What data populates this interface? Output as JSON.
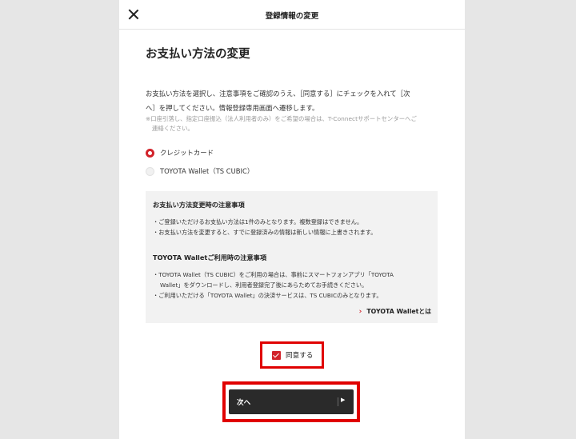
{
  "header": {
    "title": "登録情報の変更"
  },
  "page": {
    "title": "お支払い方法の変更",
    "intro_line1": "お支払い方法を選択し、注意事項をご確認のうえ、［同意する］にチェックを入れて［次",
    "intro_line2": "へ］を押してください。情報登録専用画面へ遷移します。",
    "note_line1": "※口座引落し、指定口座振込（法人利用者のみ）をご希望の場合は、T-Connectサポートセンターへご",
    "note_line2": "連絡ください。"
  },
  "payment_options": [
    {
      "label": "クレジットカード",
      "selected": true
    },
    {
      "label": "TOYOTA Wallet（TS CUBIC）",
      "selected": false
    }
  ],
  "notes": {
    "change_heading": "お支払い方法変更時の注意事項",
    "change_item1": "・ご登録いただけるお支払い方法は1件のみとなります。複数登録はできません。",
    "change_item2": "・お支払い方法を変更すると、すでに登録済みの情報は新しい情報に上書きされます。",
    "wallet_heading": "TOYOTA Walletご利用時の注意事項",
    "wallet_item1_line1": "・TOYOTA Wallet（TS CUBIC）をご利用の場合は、事前にスマートフォンアプリ「TOYOTA",
    "wallet_item1_line2": "Wallet」をダウンロードし、利用者登録完了後にあらためてお手続きください。",
    "wallet_item2": "・ご利用いただける「TOYOTA Wallet」の決済サービスは、TS CUBICのみとなります。",
    "wallet_link": "TOYOTA Walletとは"
  },
  "agree": {
    "label": "同意する",
    "checked": true
  },
  "next_button": {
    "label": "次へ"
  },
  "colors": {
    "accent": "#d2232a",
    "highlight": "#e00000",
    "button_bg": "#2a2a2a"
  }
}
